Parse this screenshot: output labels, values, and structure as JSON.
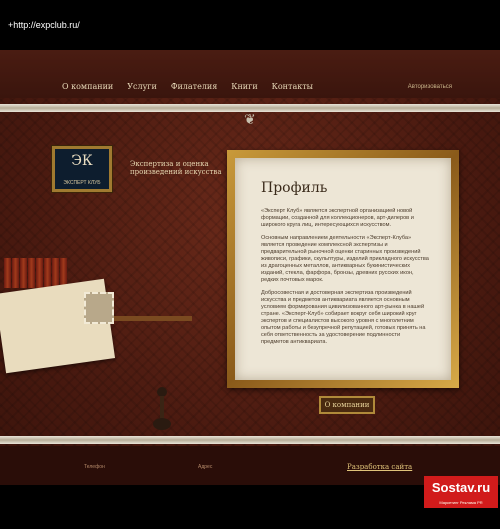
{
  "browser": {
    "url": "+http://expclub.ru/"
  },
  "nav": {
    "items": [
      "О компании",
      "Услуги",
      "Филателия",
      "Книги",
      "Контакты"
    ],
    "auth_label": "Авторизоваться"
  },
  "logo": {
    "mark": "ЭК",
    "name": "ЭКСПЕРТ КЛУБ"
  },
  "tagline": "Экспертиза и оценка произведений искусства",
  "profile": {
    "title": "Профиль",
    "paragraphs": [
      "«Эксперт Клуб» является экспертной организацией новой формации, созданной для коллекционеров, арт-дилеров и широкого круга лиц, интересующихся искусством.",
      "Основным направлением деятельности «Эксперт-Клуба» является проведение комплексной экспертизы и предварительной рыночной оценки старинных произведений живописи, графики, скульптуры, изделий прикладного искусства из драгоценных металлов, антикварных букинистических изданий, стекла, фарфора, бронзы, древних русских икон, редких почтовых марок.",
      "Добросовестная и достоверная экспертиза произведений искусства и предметов антиквариата является основным условием формирования цивилизованного арт-рынка в нашей стране. «Эксперт-Клуб» собирает вокруг себя широкий круг экспертов и специалистов высокого уровня с многолетним опытом работы и безупречной репутацией, готовых принять на себя ответственность за удостоверение подлинности предметов антиквариата."
    ],
    "button_label": "О компании"
  },
  "footer": {
    "phone_label": "Телефон",
    "address_label": "Адрес",
    "dev_link": "Разработка сайта"
  },
  "watermark": {
    "brand": "Sostav.ru",
    "sub": "Маркетинг Реклама PR"
  },
  "colors": {
    "background": "#4a1a10",
    "gold": "#b08a3a",
    "paper": "#ede6d6",
    "sostav_red": "#d11b1b"
  }
}
